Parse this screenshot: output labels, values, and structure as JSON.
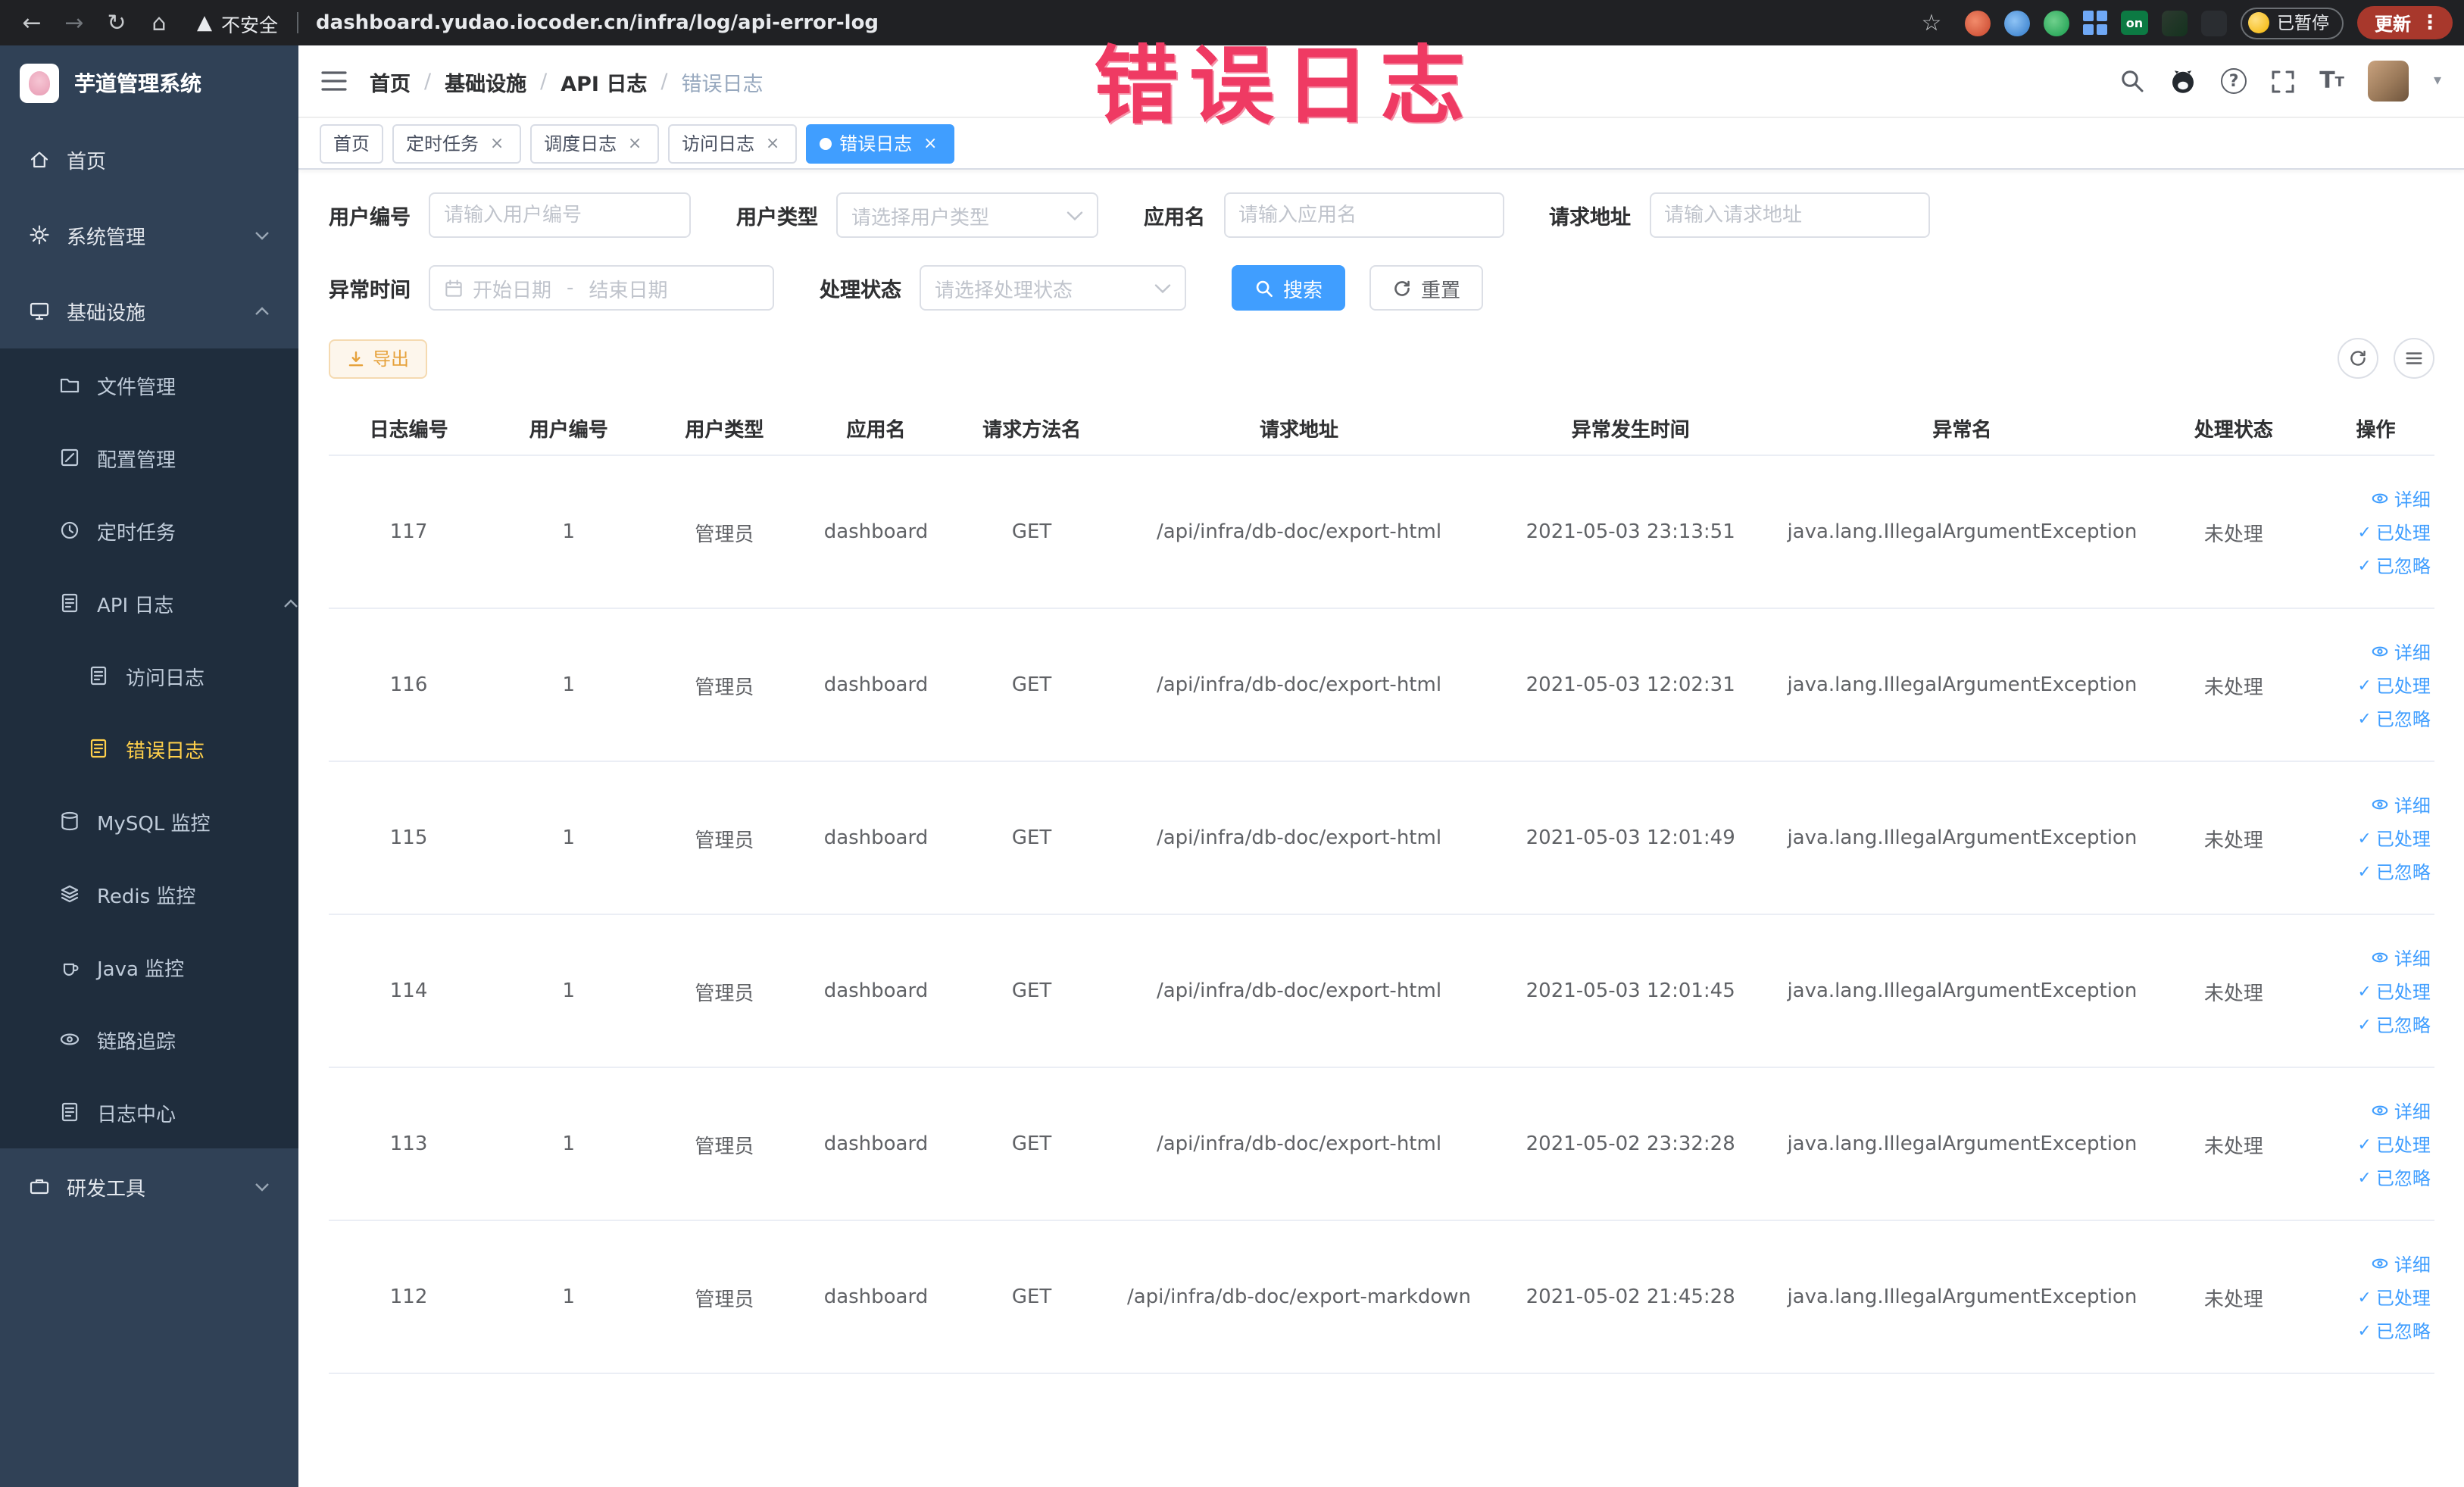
{
  "browser": {
    "security_label": "不安全",
    "url": "dashboard.yudao.iocoder.cn/infra/log/api-error-log",
    "paused_badge": "已暂停",
    "update_label": "更新"
  },
  "watermark": "错误日志",
  "sidebar": {
    "logo_title": "芋道管理系统",
    "items": [
      {
        "label": "首页"
      },
      {
        "label": "系统管理"
      },
      {
        "label": "基础设施"
      },
      {
        "label": "文件管理"
      },
      {
        "label": "配置管理"
      },
      {
        "label": "定时任务"
      },
      {
        "label": "API 日志"
      },
      {
        "label": "访问日志"
      },
      {
        "label": "错误日志"
      },
      {
        "label": "MySQL 监控"
      },
      {
        "label": "Redis 监控"
      },
      {
        "label": "Java 监控"
      },
      {
        "label": "链路追踪"
      },
      {
        "label": "日志中心"
      },
      {
        "label": "研发工具"
      }
    ]
  },
  "header": {
    "separator": "/",
    "breadcrumbs": [
      {
        "label": "首页"
      },
      {
        "label": "基础设施"
      },
      {
        "label": "API 日志"
      },
      {
        "label": "错误日志"
      }
    ]
  },
  "tabbar": {
    "close_glyph": "×",
    "tabs": [
      {
        "label": "首页"
      },
      {
        "label": "定时任务"
      },
      {
        "label": "调度日志"
      },
      {
        "label": "访问日志"
      },
      {
        "label": "错误日志"
      }
    ]
  },
  "filters": {
    "user_id": {
      "label": "用户编号",
      "placeholder": "请输入用户编号"
    },
    "user_type": {
      "label": "用户类型",
      "placeholder": "请选择用户类型"
    },
    "app_name": {
      "label": "应用名",
      "placeholder": "请输入应用名"
    },
    "request_url": {
      "label": "请求地址",
      "placeholder": "请输入请求地址"
    },
    "exception_time": {
      "label": "异常时间",
      "start_placeholder": "开始日期",
      "separator": "-",
      "end_placeholder": "结束日期"
    },
    "process_status": {
      "label": "处理状态",
      "placeholder": "请选择处理状态"
    },
    "search_button": "搜索",
    "reset_button": "重置"
  },
  "toolbar": {
    "export_button": "导出"
  },
  "table": {
    "columns": [
      "日志编号",
      "用户编号",
      "用户类型",
      "应用名",
      "请求方法名",
      "请求地址",
      "异常发生时间",
      "异常名",
      "处理状态",
      "操作"
    ],
    "actions": [
      "详细",
      "已处理",
      "已忽略"
    ],
    "rows": [
      {
        "id": "117",
        "user_id": "1",
        "user_type": "管理员",
        "app": "dashboard",
        "method": "GET",
        "url": "/api/infra/db-doc/export-html",
        "time": "2021-05-03 23:13:51",
        "exception": "java.lang.IllegalArgumentException",
        "status": "未处理"
      },
      {
        "id": "116",
        "user_id": "1",
        "user_type": "管理员",
        "app": "dashboard",
        "method": "GET",
        "url": "/api/infra/db-doc/export-html",
        "time": "2021-05-03 12:02:31",
        "exception": "java.lang.IllegalArgumentException",
        "status": "未处理"
      },
      {
        "id": "115",
        "user_id": "1",
        "user_type": "管理员",
        "app": "dashboard",
        "method": "GET",
        "url": "/api/infra/db-doc/export-html",
        "time": "2021-05-03 12:01:49",
        "exception": "java.lang.IllegalArgumentException",
        "status": "未处理"
      },
      {
        "id": "114",
        "user_id": "1",
        "user_type": "管理员",
        "app": "dashboard",
        "method": "GET",
        "url": "/api/infra/db-doc/export-html",
        "time": "2021-05-03 12:01:45",
        "exception": "java.lang.IllegalArgumentException",
        "status": "未处理"
      },
      {
        "id": "113",
        "user_id": "1",
        "user_type": "管理员",
        "app": "dashboard",
        "method": "GET",
        "url": "/api/infra/db-doc/export-html",
        "time": "2021-05-02 23:32:28",
        "exception": "java.lang.IllegalArgumentException",
        "status": "未处理"
      },
      {
        "id": "112",
        "user_id": "1",
        "user_type": "管理员",
        "app": "dashboard",
        "method": "GET",
        "url": "/api/infra/db-doc/export-markdown",
        "time": "2021-05-02 21:45:28",
        "exception": "java.lang.IllegalArgumentException",
        "status": "未处理"
      }
    ]
  }
}
